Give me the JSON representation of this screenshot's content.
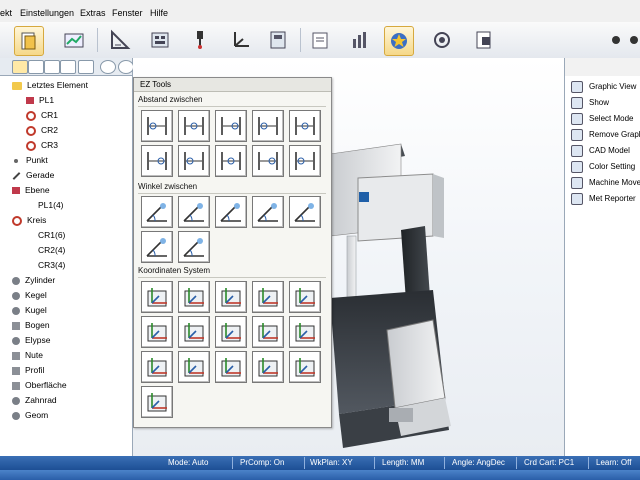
{
  "menu": [
    "ekt",
    "Einstellungen",
    "Extras",
    "Fenster",
    "Hilfe"
  ],
  "toolbar": {
    "icons": [
      "document-icon",
      "chart-edit-icon",
      "triangle-ruler-icon",
      "calculator-icon",
      "probe-icon",
      "axes-icon",
      "measure-icon",
      "folder-report-icon",
      "bar-chart-icon",
      "star-view-icon",
      "refresh-icon",
      "export-icon"
    ]
  },
  "tree": {
    "items": [
      {
        "label": "Letztes Element",
        "icon": "folder",
        "level": 0
      },
      {
        "label": "PL1",
        "icon": "plane",
        "level": 1
      },
      {
        "label": "CR1",
        "icon": "circle",
        "level": 1
      },
      {
        "label": "CR2",
        "icon": "circle",
        "level": 1
      },
      {
        "label": "CR3",
        "icon": "circle",
        "level": 1
      },
      {
        "label": "Punkt",
        "icon": "dot",
        "level": 0
      },
      {
        "label": "Gerade",
        "icon": "line",
        "level": 0
      },
      {
        "label": "Ebene",
        "icon": "plane",
        "level": 0
      },
      {
        "label": "PL1(4)",
        "icon": "none",
        "level": 2
      },
      {
        "label": "Kreis",
        "icon": "circle",
        "level": 0
      },
      {
        "label": "CR1(6)",
        "icon": "none",
        "level": 2
      },
      {
        "label": "CR2(4)",
        "icon": "none",
        "level": 2
      },
      {
        "label": "CR3(4)",
        "icon": "none",
        "level": 2
      },
      {
        "label": "Zylinder",
        "icon": "shape",
        "level": 0
      },
      {
        "label": "Kegel",
        "icon": "shape",
        "level": 0
      },
      {
        "label": "Kugel",
        "icon": "shape",
        "level": 0
      },
      {
        "label": "Bogen",
        "icon": "shape2",
        "level": 0
      },
      {
        "label": "Elypse",
        "icon": "shape",
        "level": 0
      },
      {
        "label": "Nute",
        "icon": "shape2",
        "level": 0
      },
      {
        "label": "Profil",
        "icon": "shape2",
        "level": 0
      },
      {
        "label": "Oberfläche",
        "icon": "shape2",
        "level": 0
      },
      {
        "label": "Zahnrad",
        "icon": "shape",
        "level": 0
      },
      {
        "label": "Geom",
        "icon": "shape",
        "level": 0
      }
    ]
  },
  "ez_tools": {
    "title": "EZ Tools",
    "sections": [
      {
        "label": "Abstand zwischen",
        "buttons": 10
      },
      {
        "label": "Winkel zwischen",
        "buttons": 7
      },
      {
        "label": "Koordinaten System",
        "buttons": 16
      }
    ]
  },
  "right_panel": {
    "items": [
      {
        "label": "Graphic View",
        "icon": "graphic-view-icon"
      },
      {
        "label": "Show",
        "icon": "show-icon"
      },
      {
        "label": "Select Mode",
        "icon": "select-mode-icon"
      },
      {
        "label": "Remove Graph",
        "icon": "remove-graph-icon"
      },
      {
        "label": "CAD Model",
        "icon": "cad-model-icon"
      },
      {
        "label": "Color Setting",
        "icon": "color-setting-icon"
      },
      {
        "label": "Machine Move",
        "icon": "machine-move-icon"
      },
      {
        "label": "Met Reporter",
        "icon": "met-reporter-icon"
      }
    ]
  },
  "status": {
    "mode": "Mode: Auto",
    "prcomp": "PrComp: On",
    "wkplan": "WkPlan: XY",
    "length": "Length: MM",
    "angle": "Angle: AngDec",
    "crd": "Crd Cart: PC1",
    "learn": "Learn: Off"
  },
  "colors": {
    "accent": "#1d4f95",
    "circle": "#c0392b",
    "highlight": "#f5d889"
  }
}
